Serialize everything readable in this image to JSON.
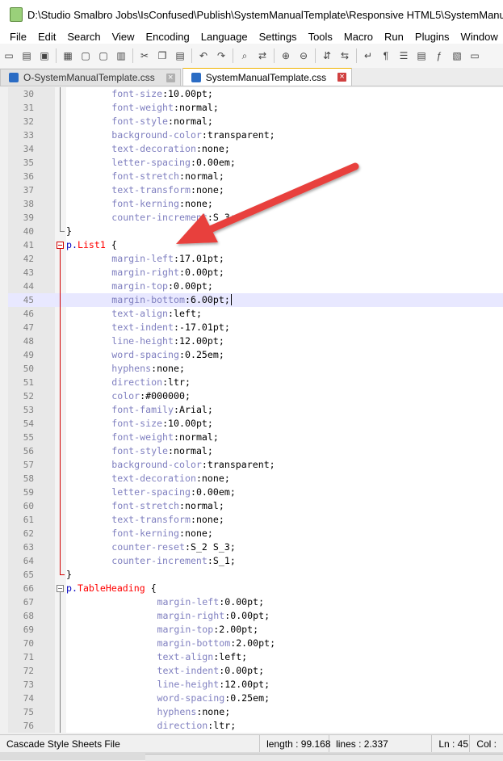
{
  "window": {
    "title": "D:\\Studio Smalbro Jobs\\IsConfused\\Publish\\SystemManualTemplate\\Responsive HTML5\\SystemManualTemplat"
  },
  "menu": [
    "File",
    "Edit",
    "Search",
    "View",
    "Encoding",
    "Language",
    "Settings",
    "Tools",
    "Macro",
    "Run",
    "Plugins",
    "Window",
    "?"
  ],
  "toolbar_icons": [
    "new-file-icon",
    "open-file-icon",
    "save-icon",
    "save-all-icon",
    "close-icon",
    "close-all-icon",
    "print-icon",
    "cut-icon",
    "copy-icon",
    "paste-icon",
    "undo-icon",
    "redo-icon",
    "find-icon",
    "replace-icon",
    "zoom-in-icon",
    "zoom-out-icon",
    "sync-v-icon",
    "sync-h-icon",
    "word-wrap-icon",
    "show-all-chars-icon",
    "indent-guide-icon",
    "doc-map-icon",
    "function-list-icon",
    "folder-workspace-icon",
    "monitor-icon"
  ],
  "tabs": [
    {
      "label": "O-SystemManualTemplate.css",
      "active": false
    },
    {
      "label": "SystemManualTemplate.css",
      "active": true
    }
  ],
  "highlighted_line": 45,
  "lines": [
    {
      "n": "30",
      "indent": 8,
      "prop": "font-size",
      "value": "10.00pt;"
    },
    {
      "n": "31",
      "indent": 8,
      "prop": "font-weight",
      "value": "normal;"
    },
    {
      "n": "32",
      "indent": 8,
      "prop": "font-style",
      "value": "normal;"
    },
    {
      "n": "33",
      "indent": 8,
      "prop": "background-color",
      "value": "transparent;"
    },
    {
      "n": "34",
      "indent": 8,
      "prop": "text-decoration",
      "value": "none;"
    },
    {
      "n": "35",
      "indent": 8,
      "prop": "letter-spacing",
      "value": "0.00em;"
    },
    {
      "n": "36",
      "indent": 8,
      "prop": "font-stretch",
      "value": "normal;"
    },
    {
      "n": "37",
      "indent": 8,
      "prop": "text-transform",
      "value": "none;"
    },
    {
      "n": "38",
      "indent": 8,
      "prop": "font-kerning",
      "value": "none;"
    },
    {
      "n": "39",
      "indent": 8,
      "prop": "counter-increment",
      "value": "S_3;"
    },
    {
      "n": "40",
      "indent": 0,
      "text": "}"
    },
    {
      "n": "41",
      "indent": 0,
      "selector": "p.List1",
      "text": " {"
    },
    {
      "n": "42",
      "indent": 8,
      "prop": "margin-left",
      "value": "17.01pt;"
    },
    {
      "n": "43",
      "indent": 8,
      "prop": "margin-right",
      "value": "0.00pt;"
    },
    {
      "n": "44",
      "indent": 8,
      "prop": "margin-top",
      "value": "0.00pt;"
    },
    {
      "n": "45",
      "indent": 8,
      "prop": "margin-bottom",
      "value": "6.00pt;"
    },
    {
      "n": "46",
      "indent": 8,
      "prop": "text-align",
      "value": "left;"
    },
    {
      "n": "47",
      "indent": 8,
      "prop": "text-indent",
      "value": "-17.01pt;"
    },
    {
      "n": "48",
      "indent": 8,
      "prop": "line-height",
      "value": "12.00pt;"
    },
    {
      "n": "49",
      "indent": 8,
      "prop": "word-spacing",
      "value": "0.25em;"
    },
    {
      "n": "50",
      "indent": 8,
      "prop": "hyphens",
      "value": "none;"
    },
    {
      "n": "51",
      "indent": 8,
      "prop": "direction",
      "value": "ltr;"
    },
    {
      "n": "52",
      "indent": 8,
      "prop": "color",
      "value": "#000000;"
    },
    {
      "n": "53",
      "indent": 8,
      "prop": "font-family",
      "value": "Arial;"
    },
    {
      "n": "54",
      "indent": 8,
      "prop": "font-size",
      "value": "10.00pt;"
    },
    {
      "n": "55",
      "indent": 8,
      "prop": "font-weight",
      "value": "normal;"
    },
    {
      "n": "56",
      "indent": 8,
      "prop": "font-style",
      "value": "normal;"
    },
    {
      "n": "57",
      "indent": 8,
      "prop": "background-color",
      "value": "transparent;"
    },
    {
      "n": "58",
      "indent": 8,
      "prop": "text-decoration",
      "value": "none;"
    },
    {
      "n": "59",
      "indent": 8,
      "prop": "letter-spacing",
      "value": "0.00em;"
    },
    {
      "n": "60",
      "indent": 8,
      "prop": "font-stretch",
      "value": "normal;"
    },
    {
      "n": "61",
      "indent": 8,
      "prop": "text-transform",
      "value": "none;"
    },
    {
      "n": "62",
      "indent": 8,
      "prop": "font-kerning",
      "value": "none;"
    },
    {
      "n": "63",
      "indent": 8,
      "prop": "counter-reset",
      "value": "S_2 S_3;"
    },
    {
      "n": "64",
      "indent": 8,
      "prop": "counter-increment",
      "value": "S_1;"
    },
    {
      "n": "65",
      "indent": 0,
      "text": "}"
    },
    {
      "n": "66",
      "indent": 0,
      "selector": "p.TableHeading",
      "text": " {"
    },
    {
      "n": "67",
      "indent": 16,
      "prop": "margin-left",
      "value": "0.00pt;"
    },
    {
      "n": "68",
      "indent": 16,
      "prop": "margin-right",
      "value": "0.00pt;"
    },
    {
      "n": "69",
      "indent": 16,
      "prop": "margin-top",
      "value": "2.00pt;"
    },
    {
      "n": "70",
      "indent": 16,
      "prop": "margin-bottom",
      "value": "2.00pt;"
    },
    {
      "n": "71",
      "indent": 16,
      "prop": "text-align",
      "value": "left;"
    },
    {
      "n": "72",
      "indent": 16,
      "prop": "text-indent",
      "value": "0.00pt;"
    },
    {
      "n": "73",
      "indent": 16,
      "prop": "line-height",
      "value": "12.00pt;"
    },
    {
      "n": "74",
      "indent": 16,
      "prop": "word-spacing",
      "value": "0.25em;"
    },
    {
      "n": "75",
      "indent": 16,
      "prop": "hyphens",
      "value": "none;"
    },
    {
      "n": "76",
      "indent": 16,
      "prop": "direction",
      "value": "ltr;"
    }
  ],
  "status": {
    "file_type": "Cascade Style Sheets File",
    "length": "length : 99.168",
    "lines": "lines : 2.337",
    "ln": "Ln : 45",
    "col": "Col :"
  },
  "colors": {
    "property": "#8080c0",
    "selector": "#ff0000",
    "fold_marker": "#d00000",
    "arrow": "#e8413c",
    "highlight": "#e8e8ff"
  }
}
